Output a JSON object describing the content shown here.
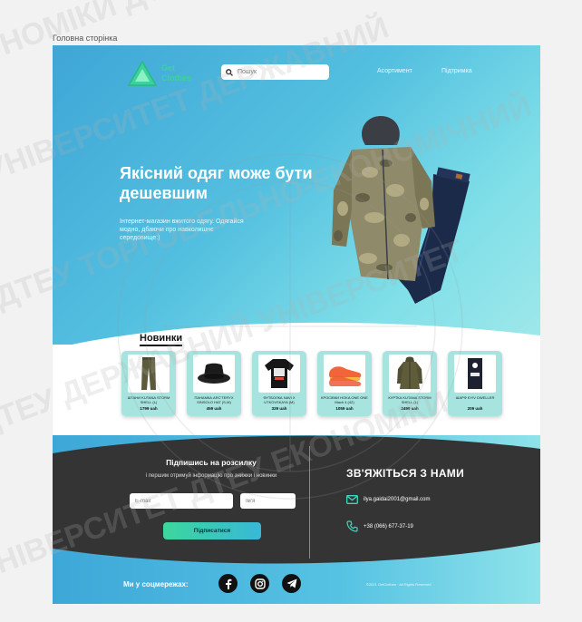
{
  "page_caption": "Головна сторінка",
  "header": {
    "logo_line1": "Get",
    "logo_line2": "Clothes",
    "search_placeholder": "Пошук",
    "nav": [
      "Асортимент",
      "Підтримка"
    ]
  },
  "hero": {
    "title": "Якісний одяг може бути дешевшим",
    "subtitle": "Інтернет-магазин вжитого одягу. Одягайся модно, дбаючи про навколишнє середовище:)"
  },
  "new_products": {
    "title": "Новинки",
    "items": [
      {
        "name": "ШТАНИ KUTANA STORM SHELL (L)",
        "price": "1799 uah",
        "icon": "pants-icon"
      },
      {
        "name": "ПАНАМКА ARC'TERYX SINSOLO HAT (S-M)",
        "price": "459 uah",
        "icon": "bucket-hat-icon"
      },
      {
        "name": "ФУТБОЛКА NAVI X UTKOVSKAYA (M)",
        "price": "329 uah",
        "icon": "tshirt-icon"
      },
      {
        "name": "КРОСІВКИ HOKA ONE ONE Mach 4 (42)",
        "price": "1059 uah",
        "icon": "sneakers-icon"
      },
      {
        "name": "КУРТКА KUTANA STORM SHELL (L)",
        "price": "2499 uah",
        "icon": "jacket-icon"
      },
      {
        "name": "ШАРФ KYIV DWELLER",
        "price": "209 uah",
        "icon": "scarf-icon"
      }
    ]
  },
  "subscribe": {
    "title": "Підпишись на розсилку",
    "text": "і першим отримуй інформацію про знижки і новинки",
    "email_placeholder": "E-mail",
    "name_placeholder": "Ім'я",
    "button": "Підписатися"
  },
  "contact": {
    "title": "ЗВ'ЯЖІТЬСЯ З НАМИ",
    "email": "ilya.gaidai2001@gmail.com",
    "phone": "+38 (066) 677-37-19"
  },
  "footer": {
    "social_label": "Ми у соцмережах:",
    "socials": [
      "facebook-icon",
      "instagram-icon",
      "telegram-icon"
    ],
    "copyright": "©2021 GetClothes · All Rights Reserved"
  },
  "colors": {
    "hero_start": "#3fa6d6",
    "hero_end": "#9fe8ea",
    "card": "#a7e4df",
    "footer_dark": "#333333",
    "accent_green": "#3cd79c"
  }
}
